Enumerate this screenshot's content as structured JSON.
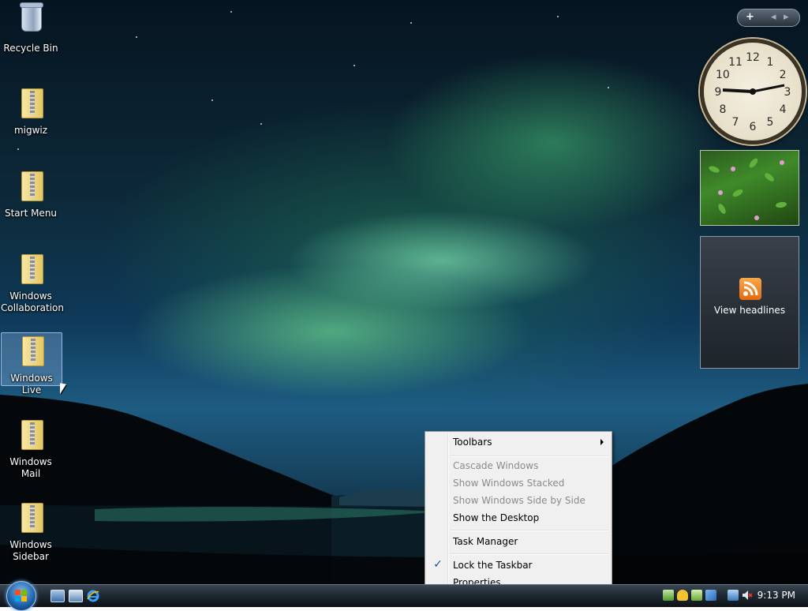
{
  "desktop_icons": [
    {
      "label": "Recycle Bin",
      "icon": "recycle-bin-icon"
    },
    {
      "label": "migwiz",
      "icon": "zip-folder-icon"
    },
    {
      "label": "Start Menu",
      "icon": "zip-folder-icon"
    },
    {
      "label": "Windows Collaboration",
      "icon": "zip-folder-icon"
    },
    {
      "label": "Windows Live",
      "icon": "zip-folder-icon"
    },
    {
      "label": "Windows Mail",
      "icon": "zip-folder-icon"
    },
    {
      "label": "Windows Sidebar",
      "icon": "zip-folder-icon"
    }
  ],
  "sidebar": {
    "add_label": "+",
    "prev_label": "◂",
    "next_label": "▸",
    "clock": {
      "numerals": [
        "12",
        "1",
        "2",
        "3",
        "4",
        "5",
        "6",
        "7",
        "8",
        "9",
        "10",
        "11"
      ],
      "time_shown": "9:13"
    },
    "feeds": {
      "title": "View headlines"
    }
  },
  "context_menu": {
    "items": [
      {
        "label": "Toolbars",
        "enabled": true,
        "submenu": true
      },
      {
        "label": "Cascade Windows",
        "enabled": false
      },
      {
        "label": "Show Windows Stacked",
        "enabled": false
      },
      {
        "label": "Show Windows Side by Side",
        "enabled": false
      },
      {
        "label": "Show the Desktop",
        "enabled": true
      },
      {
        "label": "Task Manager",
        "enabled": true
      },
      {
        "label": "Lock the Taskbar",
        "enabled": true,
        "checked": true
      },
      {
        "label": "Properties",
        "enabled": true
      }
    ]
  },
  "taskbar": {
    "start_icon": "windows-logo-icon",
    "quick_launch": [
      "show-desktop-icon",
      "switch-windows-icon",
      "internet-explorer-icon"
    ],
    "tray_icons": [
      "network-icon",
      "security-alert-icon",
      "windows-defender-icon",
      "update-icon",
      "network-status-icon",
      "volume-muted-icon"
    ],
    "clock": "9:13 PM"
  },
  "colors": {
    "menu_background": "#f0f0f0",
    "menu_disabled_text": "#8b8b8b",
    "check_color": "#1a4fa3"
  }
}
